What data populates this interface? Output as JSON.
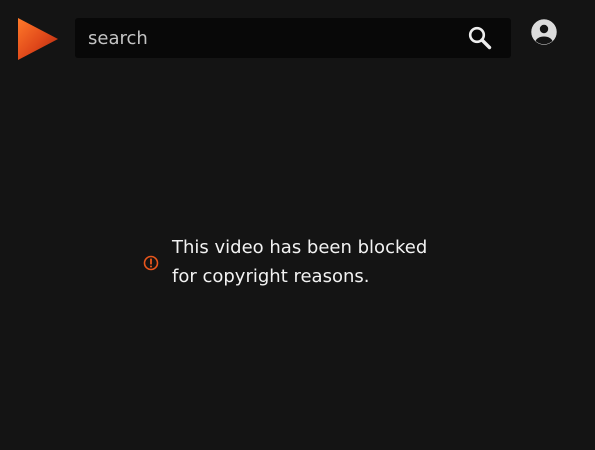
{
  "header": {
    "logo_icon": "play-triangle-logo-icon",
    "search": {
      "placeholder": "search",
      "value": "",
      "button_icon": "magnifier-icon"
    },
    "account_icon": "account-circle-icon"
  },
  "main": {
    "notice": {
      "icon": "warning-circle-icon",
      "line_1": "This video has been blocked",
      "line_2": "for copyright reasons."
    }
  },
  "colors": {
    "background": "#141414",
    "search_background": "#080808",
    "accent_orange": "#e8561c",
    "text": "#f2f2f2"
  }
}
